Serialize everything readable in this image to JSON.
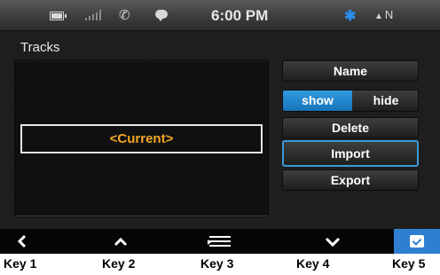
{
  "status_bar": {
    "time": "6:00 PM",
    "nav_label": "N",
    "bluetooth_icon": "bluetooth-icon",
    "icons": [
      "battery-icon",
      "signal-icon",
      "phone-icon",
      "message-icon",
      "bluetooth-icon",
      "compass-icon"
    ]
  },
  "page": {
    "title": "Tracks"
  },
  "track_list": {
    "items": [
      "<Current>"
    ],
    "selected_color": "#f4a623"
  },
  "actions": {
    "name_label": "Name",
    "show_label": "show",
    "hide_label": "hide",
    "show_hide_selected": "show",
    "delete_label": "Delete",
    "import_label": "Import",
    "export_label": "Export",
    "accent_color": "#3a9ad9"
  },
  "soft_keys": {
    "icons": [
      "back-icon",
      "up-icon",
      "menu-icon",
      "down-icon",
      "confirm-icon"
    ],
    "labels": [
      "Key 1",
      "Key 2",
      "Key 3",
      "Key 4",
      "Key 5"
    ]
  }
}
